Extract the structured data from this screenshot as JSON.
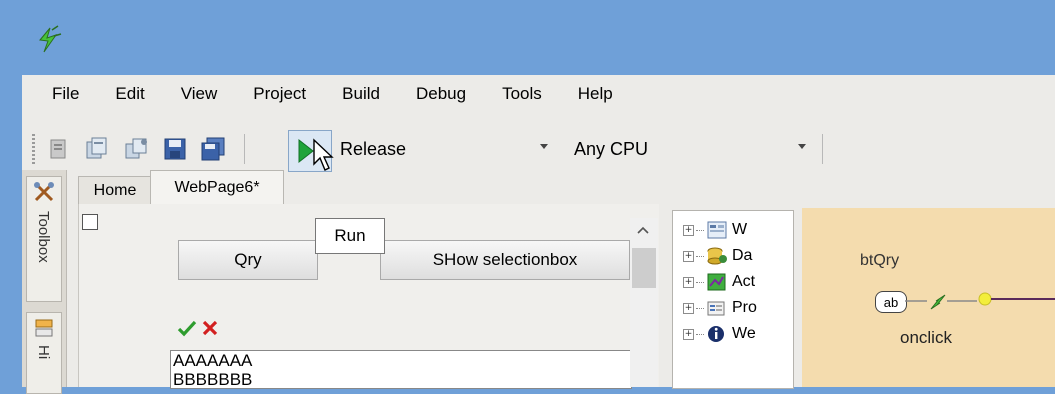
{
  "menu": [
    "File",
    "Edit",
    "View",
    "Project",
    "Build",
    "Debug",
    "Tools",
    "Help"
  ],
  "toolbar": {
    "configuration": "Release",
    "platform": "Any CPU",
    "run_tooltip": "Run"
  },
  "left_dock": {
    "toolbox_label": "Toolbox",
    "second_label": "Hi"
  },
  "tabs": [
    "Home",
    "WebPage6*"
  ],
  "designer": {
    "buttons": [
      "Qry",
      "SHow selectionbox"
    ],
    "list_items": [
      "AAAAAAA",
      "BBBBBBB"
    ]
  },
  "tree": {
    "items": [
      "W",
      "Da",
      "Act",
      "Pro",
      "We"
    ]
  },
  "flow": {
    "control_name": "btQry",
    "control_type": "ab",
    "event": "onclick"
  },
  "colors": {
    "title_bar": "#6fa0d8",
    "client_bg": "#ecebe8",
    "flow_bg": "#f4dcae",
    "check_green": "#2e9c2e",
    "cross_red": "#d22020"
  }
}
